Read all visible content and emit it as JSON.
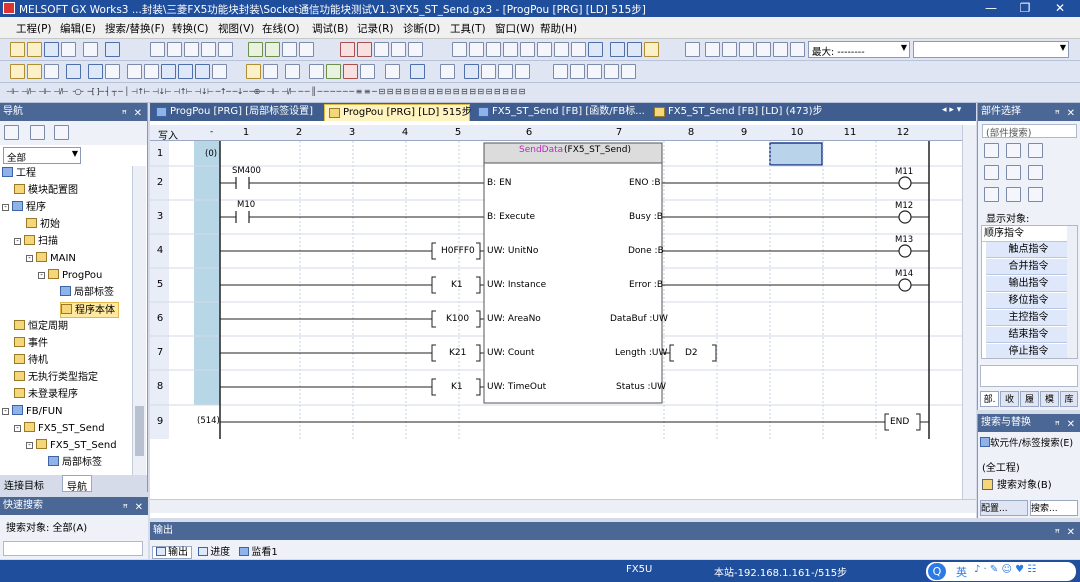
{
  "window": {
    "title": "MELSOFT GX Works3 ...封装\\三菱FX5功能块封装\\Socket通信功能块测试V1.3\\FX5_ST_Send.gx3 - [ProgPou [PRG] [LD] 515步]",
    "min": "—",
    "restore": "❐",
    "close": "✕"
  },
  "menu": [
    "工程(P)",
    "编辑(E)",
    "搜索/替换(F)",
    "转换(C)",
    "视图(V)",
    "在线(O)",
    "调试(B)",
    "记录(R)",
    "诊断(D)",
    "工具(T)",
    "窗口(W)",
    "帮助(H)"
  ],
  "toolbar1": {
    "zoom_label": "最大: --------"
  },
  "navigator": {
    "title": "导航",
    "filter": "全部",
    "tree": [
      {
        "label": "工程",
        "level": 0,
        "icon": "project-icon"
      },
      {
        "label": "模块配置图",
        "level": 1,
        "icon": "module-config-icon"
      },
      {
        "label": "程序",
        "level": 0,
        "icon": "folder-icon"
      },
      {
        "label": "初始",
        "level": 2,
        "icon": "folder-icon"
      },
      {
        "label": "扫描",
        "level": 1,
        "icon": "folder-icon"
      },
      {
        "label": "MAIN",
        "level": 2,
        "icon": "folder-icon"
      },
      {
        "label": "ProgPou",
        "level": 3,
        "icon": "program-icon"
      },
      {
        "label": "局部标签",
        "level": 4,
        "icon": "label-icon"
      },
      {
        "label": "程序本体",
        "level": 4,
        "icon": "program-body-icon",
        "selected": true
      },
      {
        "label": "恒定周期",
        "level": 1,
        "icon": "folder-icon"
      },
      {
        "label": "事件",
        "level": 1,
        "icon": "folder-icon"
      },
      {
        "label": "待机",
        "level": 1,
        "icon": "folder-icon"
      },
      {
        "label": "无执行类型指定",
        "level": 1,
        "icon": "folder-icon"
      },
      {
        "label": "未登录程序",
        "level": 1,
        "icon": "folder-icon"
      },
      {
        "label": "FB/FUN",
        "level": 0,
        "icon": "folder-icon"
      },
      {
        "label": "FX5_ST_Send",
        "level": 1,
        "icon": "folder-icon"
      },
      {
        "label": "FX5_ST_Send",
        "level": 2,
        "icon": "fb-icon"
      },
      {
        "label": "局部标签",
        "level": 3,
        "icon": "label-icon"
      },
      {
        "label": "程序本体",
        "level": 3,
        "icon": "program-body-icon"
      }
    ],
    "bottom_tabs": [
      "连接目标",
      "导航"
    ]
  },
  "quick_search": {
    "title": "快速搜索",
    "target": "搜索对象: 全部(A)"
  },
  "tabs": [
    {
      "label": "ProgPou [PRG] [局部标签设置]",
      "active": false
    },
    {
      "label": "ProgPou [PRG] [LD] 515步",
      "active": true
    },
    {
      "label": "FX5_ST_Send [FB] [函数/FB标...",
      "active": false
    },
    {
      "label": "FX5_ST_Send [FB] [LD] (473)步",
      "active": false
    }
  ],
  "ladder": {
    "write_label": "写入",
    "columns": [
      "1",
      "2",
      "3",
      "4",
      "5",
      "6",
      "7",
      "8",
      "9",
      "10",
      "11",
      "12"
    ],
    "rows": [
      "1",
      "2",
      "3",
      "4",
      "5",
      "6",
      "7",
      "8",
      "9"
    ],
    "step_start": "(0)",
    "step_end": "(514)",
    "contacts": [
      "SM400",
      "M10"
    ],
    "coils": [
      "M11",
      "M12",
      "M13",
      "M14"
    ],
    "fb_instance": "SendData",
    "fb_type": "(FX5_ST_Send)",
    "inputs": [
      {
        "operand": "",
        "pin": "B: EN"
      },
      {
        "operand": "",
        "pin": "B: Execute"
      },
      {
        "operand": "H0FFF0",
        "pin": "UW: UnitNo"
      },
      {
        "operand": "K1",
        "pin": "UW: Instance"
      },
      {
        "operand": "K100",
        "pin": "UW: AreaNo"
      },
      {
        "operand": "K21",
        "pin": "UW: Count"
      },
      {
        "operand": "K1",
        "pin": "UW: TimeOut"
      }
    ],
    "outputs": [
      {
        "pin": "ENO :B"
      },
      {
        "pin": "Busy :B"
      },
      {
        "pin": "Done :B"
      },
      {
        "pin": "Error :B"
      },
      {
        "pin": "DataBuf :UW"
      },
      {
        "pin": "Length :UW",
        "operand": "D2"
      },
      {
        "pin": "Status :UW"
      }
    ],
    "end_label": "END"
  },
  "parts": {
    "title": "部件选择",
    "search_placeholder": "(部件搜索)",
    "display_label": "显示对象:",
    "items": [
      "顺序指令",
      "触点指令",
      "合并指令",
      "输出指令",
      "移位指令",
      "主控指令",
      "结束指令",
      "停止指令"
    ],
    "bottom_tabs": [
      "部.",
      "收",
      "履",
      "模",
      "库"
    ]
  },
  "search_replace": {
    "title": "搜索与替换",
    "tab": "软元件/标签搜索(E)",
    "scope": "(全工程)",
    "target": "搜索对象(B)",
    "bottom_tabs": [
      "配置...",
      "搜索..."
    ]
  },
  "output": {
    "title": "输出",
    "tabs": [
      "输出",
      "进度",
      "监看1"
    ]
  },
  "status": {
    "cpu": "FX5U",
    "station": "本站-192.168.1.161",
    "steps": "-/515步",
    "ime": "英"
  }
}
